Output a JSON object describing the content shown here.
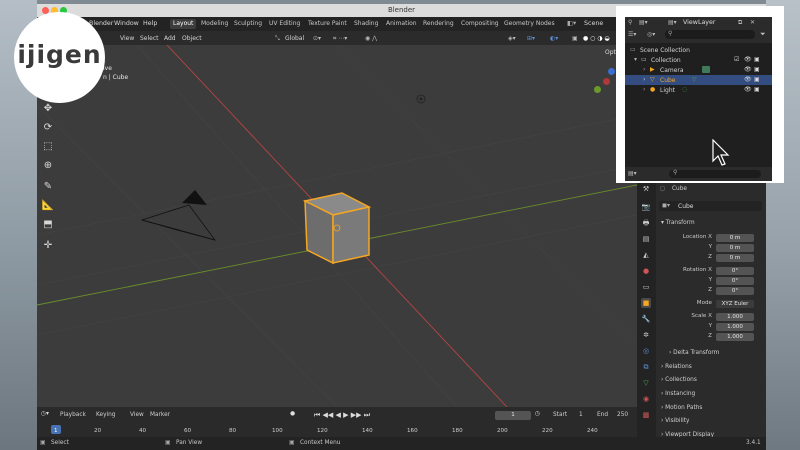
{
  "window": {
    "title": "Blender"
  },
  "menubar": {
    "menus": [
      "Blender",
      "Window",
      "Help"
    ],
    "workspaces": [
      "Layout",
      "Modeling",
      "Sculpting",
      "UV Editing",
      "Texture Paint",
      "Shading",
      "Animation",
      "Rendering",
      "Compositing",
      "Geometry Nodes"
    ],
    "active_workspace": "Layout",
    "scene": "Scene"
  },
  "viewport_header": {
    "menus": [
      "View",
      "Select",
      "Add",
      "Object"
    ],
    "transform_orientation": "Global"
  },
  "viewport": {
    "overlay_line1": "ive",
    "overlay_line2": "n | Cube",
    "options_label": "Opti"
  },
  "outliner": {
    "view_layer": "ViewLayer",
    "search_placeholder": "",
    "items": [
      {
        "label": "Scene Collection"
      },
      {
        "label": "Collection"
      },
      {
        "label": "Camera"
      },
      {
        "label": "Cube"
      },
      {
        "label": "Light"
      }
    ]
  },
  "properties": {
    "object_name_top": "Cube",
    "object_name": "Cube",
    "transform_label": "Transform",
    "location": {
      "label": "Location X",
      "x": "0 m",
      "y": "0 m",
      "z": "0 m"
    },
    "rotation": {
      "label": "Rotation X",
      "x": "0°",
      "y": "0°",
      "z": "0°"
    },
    "mode": {
      "label": "Mode",
      "value": "XYZ Euler"
    },
    "scale": {
      "label": "Scale X",
      "x": "1.000",
      "y": "1.000",
      "z": "1.000"
    },
    "axis_y": "Y",
    "axis_z": "Z",
    "sections": [
      "Delta Transform",
      "Relations",
      "Collections",
      "Instancing",
      "Motion Paths",
      "Visibility",
      "Viewport Display"
    ]
  },
  "timeline": {
    "menus": [
      "Playback",
      "Keying",
      "View",
      "Marker"
    ],
    "current_frame": "1",
    "start_label": "Start",
    "start": "1",
    "end_label": "End",
    "end": "250",
    "frame_ticks": [
      "1",
      "20",
      "40",
      "60",
      "80",
      "100",
      "120",
      "140",
      "160",
      "180",
      "200",
      "220",
      "240"
    ]
  },
  "statusbar": {
    "select": "Select",
    "pan": "Pan View",
    "context": "Context Menu",
    "version": "3.4.1"
  },
  "logo": {
    "text": "ijigen"
  },
  "colors": {
    "accent": "#4772b3",
    "selection": "#f5a623",
    "x_axis": "#b84444",
    "y_axis": "#6b8f2a"
  }
}
